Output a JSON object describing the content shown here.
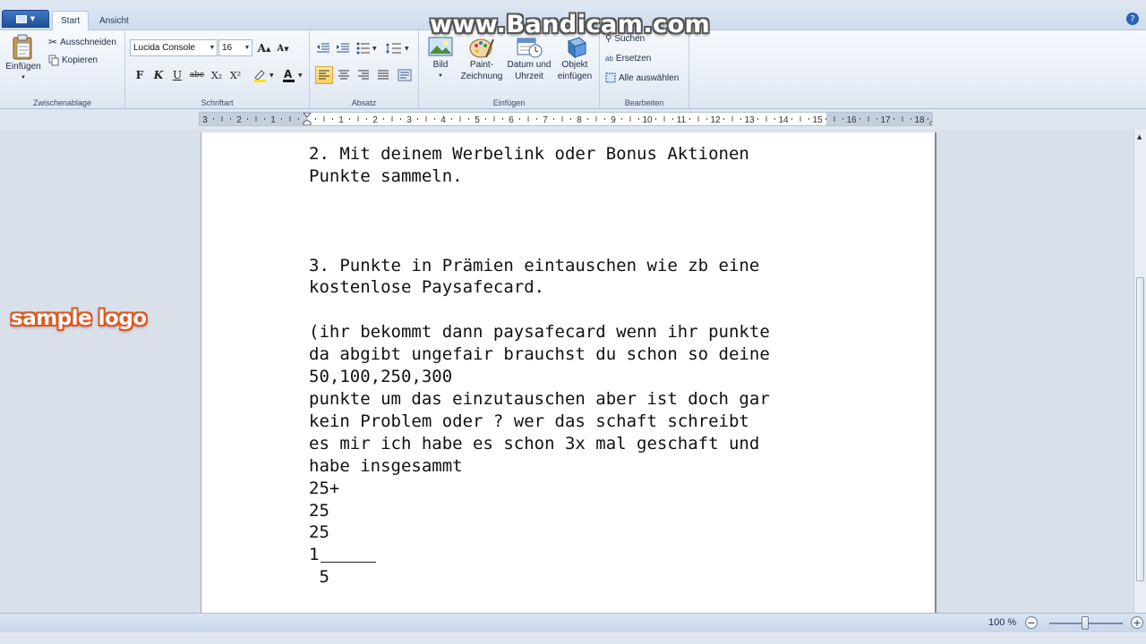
{
  "app": {
    "file_label": "",
    "tabs": [
      "Start",
      "Ansicht"
    ],
    "active_tab": "Start"
  },
  "ribbon": {
    "clipboard": {
      "group_label": "Zwischenablage",
      "paste": "Einfügen",
      "cut": "Ausschneiden",
      "copy": "Kopieren"
    },
    "font": {
      "group_label": "Schriftart",
      "font_name": "Lucida Console",
      "font_size": "16",
      "bold": "F",
      "italic": "K",
      "underline": "U",
      "strike": "abc",
      "subscript": "X₂",
      "superscript": "X²"
    },
    "paragraph": {
      "group_label": "Absatz"
    },
    "insert": {
      "group_label": "Einfügen",
      "picture": "Bild",
      "paint": "Paint-\nZeichnung",
      "datetime": "Datum und\nUhrzeit",
      "object": "Objekt\neinfügen"
    },
    "editing": {
      "group_label": "Bearbeiten",
      "find": "Suchen",
      "replace": "Ersetzen",
      "select_all": "Alle auswählen"
    }
  },
  "ruler": {
    "labels": [
      "3",
      "2",
      "1",
      "1",
      "2",
      "3",
      "4",
      "5",
      "6",
      "7",
      "8",
      "9",
      "10",
      "11",
      "12",
      "13",
      "14",
      "15",
      "16",
      "17",
      "18"
    ]
  },
  "document": {
    "lines": [
      "2. Mit deinem Werbelink oder Bonus Aktionen",
      "Punkte sammeln.",
      "",
      "",
      "",
      "3. Punkte in Prämien eintauschen wie zb eine",
      "kostenlose Paysafecard.",
      "",
      "(ihr bekommt dann paysafecard wenn ihr punkte",
      "da abgibt ungefair brauchst du schon so deine",
      "50,100,250,300",
      "punkte um das einzutauschen aber ist doch gar",
      "kein Problem oder ? wer das schaft schreibt",
      "es mir ich habe es schon 3x mal geschaft und",
      "habe insgesammt",
      "25+",
      "25",
      "25"
    ],
    "last_line": "1",
    "sum_line": " 5"
  },
  "status": {
    "zoom": "100 %",
    "zoom_out": "−",
    "zoom_in": "+",
    "zoom_level_percent": 100
  },
  "overlays": {
    "watermark": "www.Bandicam.com",
    "logo": "sample logo"
  }
}
